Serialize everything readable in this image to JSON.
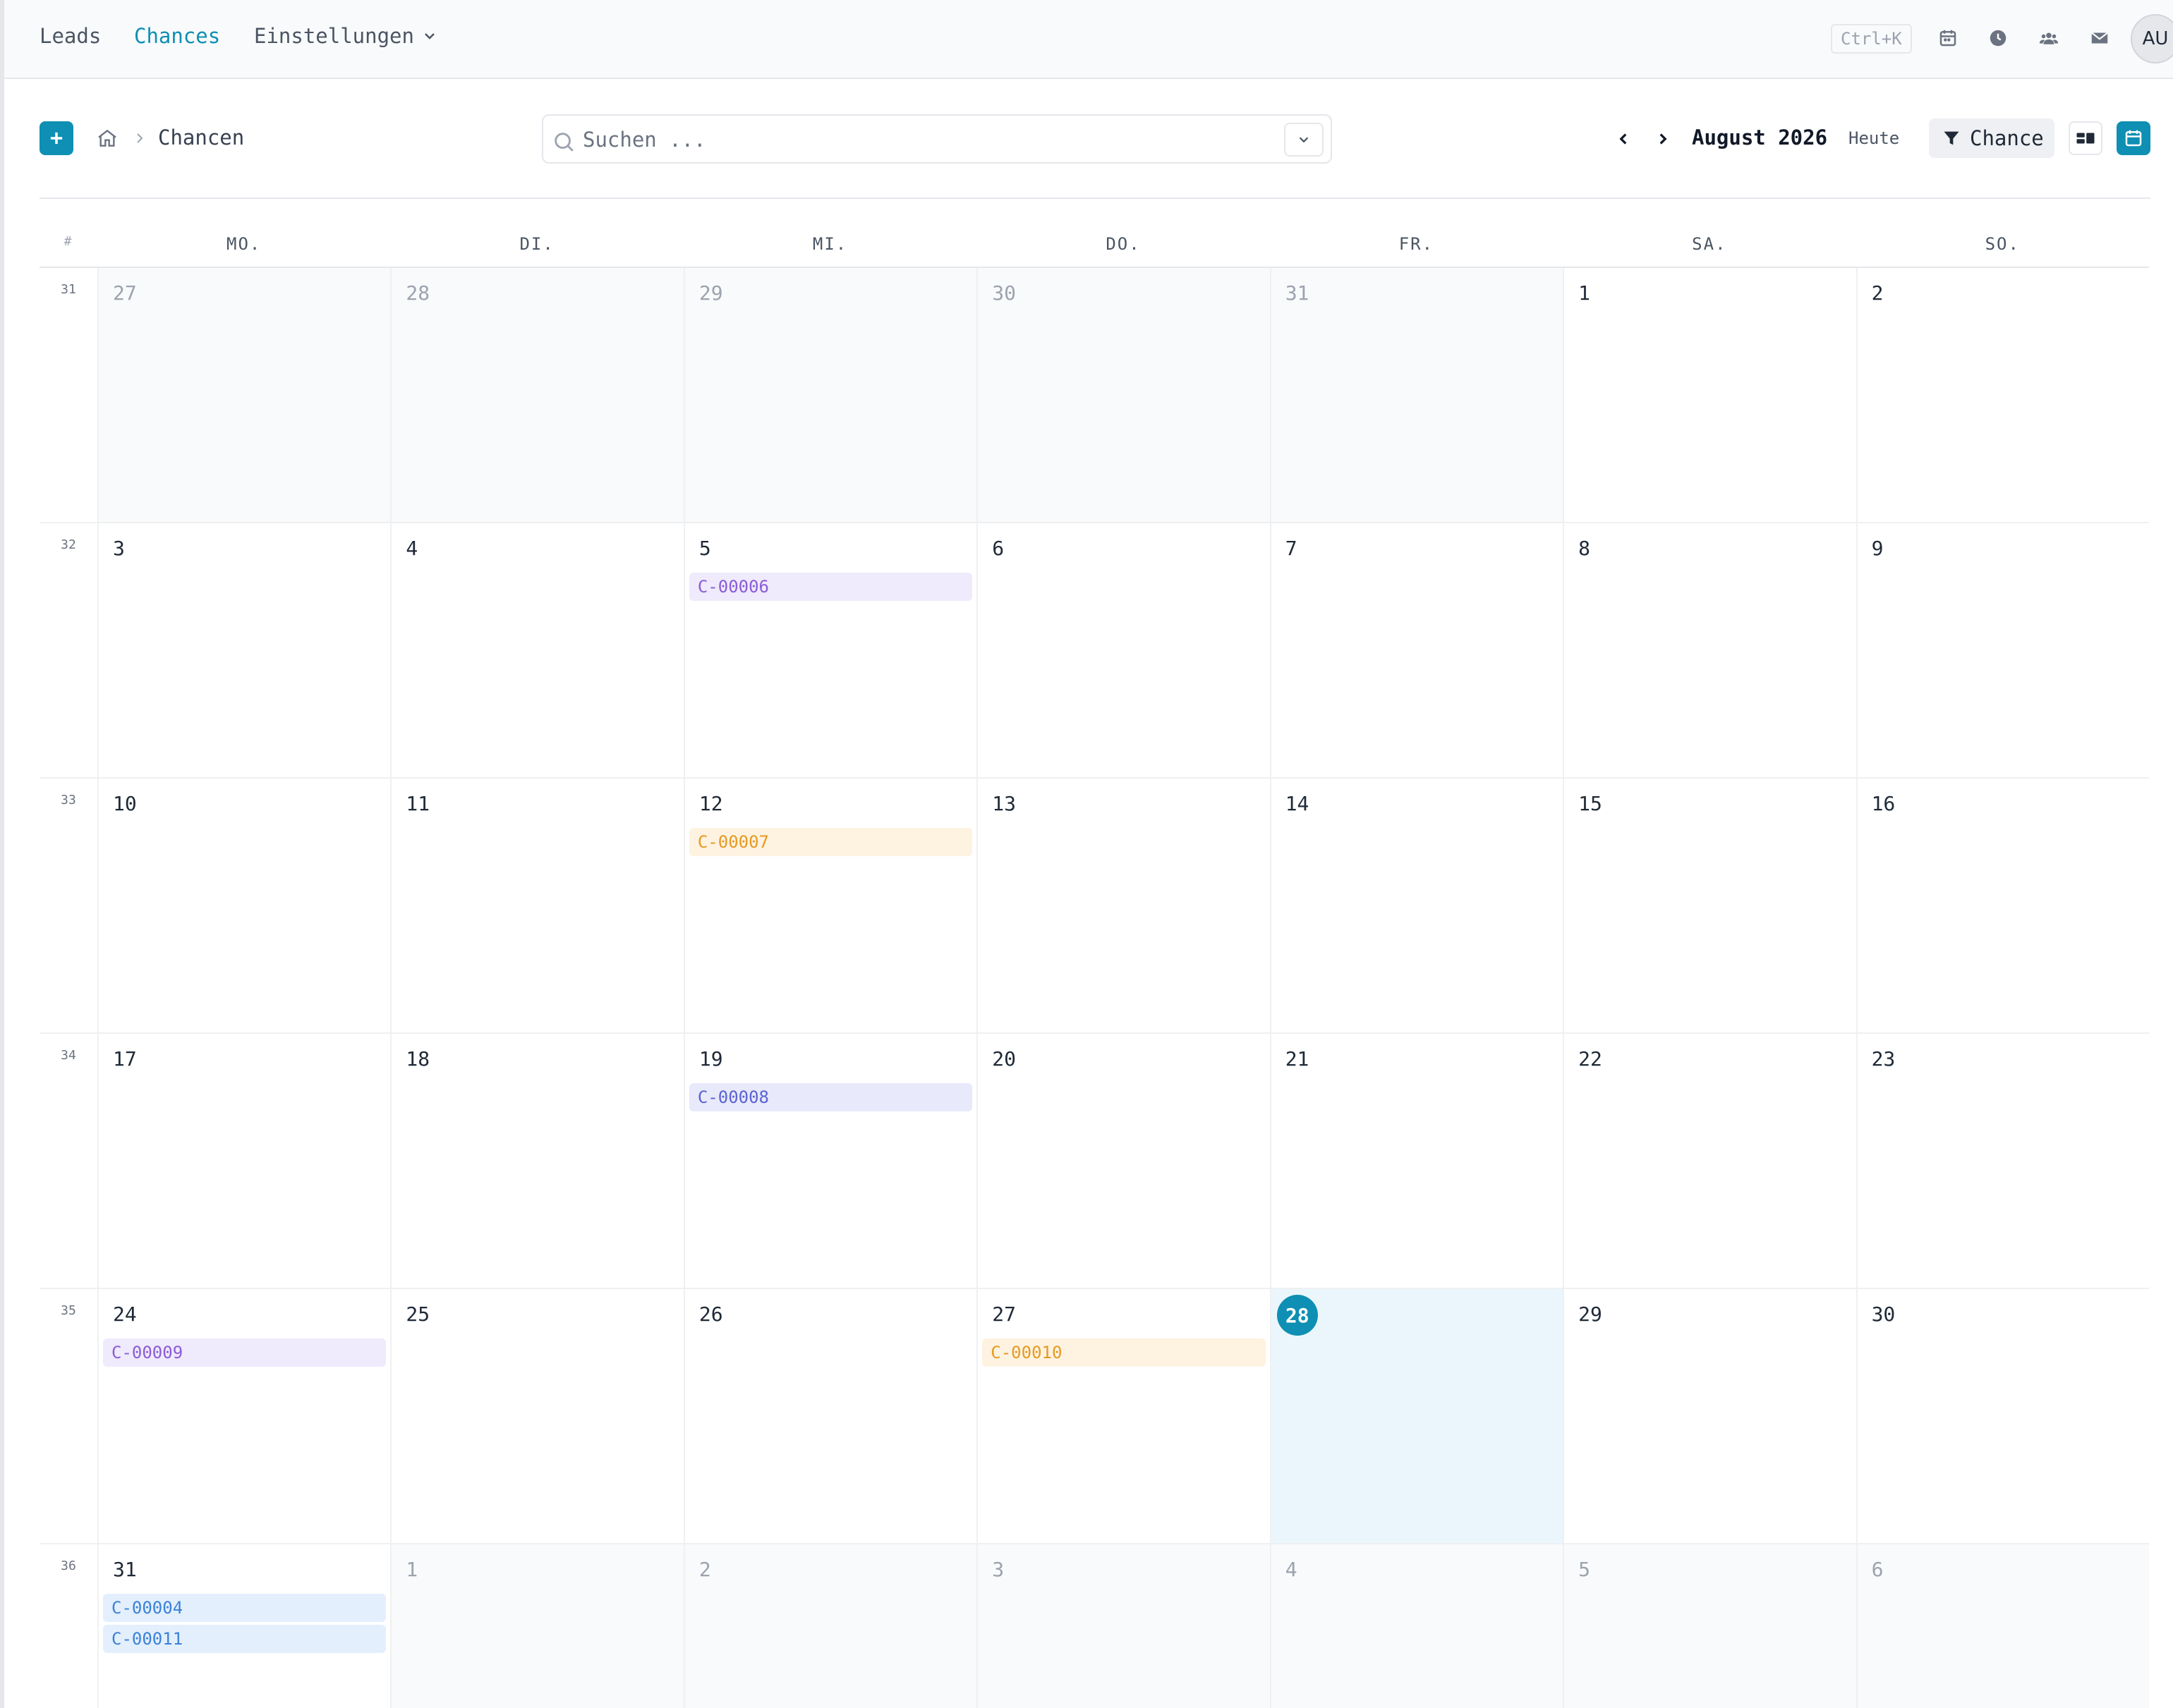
{
  "nav": {
    "leads": "Leads",
    "chances": "Chances",
    "settings": "Einstellungen",
    "shortcut": "Ctrl+K",
    "avatar": "AU",
    "icons": [
      "calendar-icon",
      "clock-icon",
      "users-icon",
      "mail-icon"
    ]
  },
  "breadcrumb": {
    "current": "Chancen"
  },
  "search": {
    "placeholder": "Suchen ..."
  },
  "calendar_nav": {
    "month": "August 2026",
    "today": "Heute",
    "filter": "Chance"
  },
  "colors": {
    "accent": "#0e8fb3",
    "event_purple": "#8b5cd6",
    "event_orange": "#e79a21",
    "event_indigo": "#5b63d3",
    "event_blue": "#3b82d6"
  },
  "calendar": {
    "week_header": "#",
    "weekdays": [
      "MO.",
      "DI.",
      "MI.",
      "DO.",
      "FR.",
      "SA.",
      "SO."
    ],
    "weeks": [
      {
        "number": "31",
        "days": [
          {
            "n": "27",
            "muted": true
          },
          {
            "n": "28",
            "muted": true
          },
          {
            "n": "29",
            "muted": true
          },
          {
            "n": "30",
            "muted": true
          },
          {
            "n": "31",
            "muted": true
          },
          {
            "n": "1"
          },
          {
            "n": "2"
          }
        ]
      },
      {
        "number": "32",
        "days": [
          {
            "n": "3"
          },
          {
            "n": "4"
          },
          {
            "n": "5",
            "events": [
              {
                "label": "C-00006",
                "color": "purple"
              }
            ]
          },
          {
            "n": "6"
          },
          {
            "n": "7"
          },
          {
            "n": "8"
          },
          {
            "n": "9"
          }
        ]
      },
      {
        "number": "33",
        "days": [
          {
            "n": "10"
          },
          {
            "n": "11"
          },
          {
            "n": "12",
            "events": [
              {
                "label": "C-00007",
                "color": "orange"
              }
            ]
          },
          {
            "n": "13"
          },
          {
            "n": "14"
          },
          {
            "n": "15"
          },
          {
            "n": "16"
          }
        ]
      },
      {
        "number": "34",
        "days": [
          {
            "n": "17"
          },
          {
            "n": "18"
          },
          {
            "n": "19",
            "events": [
              {
                "label": "C-00008",
                "color": "indigo"
              }
            ]
          },
          {
            "n": "20"
          },
          {
            "n": "21"
          },
          {
            "n": "22"
          },
          {
            "n": "23"
          }
        ]
      },
      {
        "number": "35",
        "days": [
          {
            "n": "24",
            "events": [
              {
                "label": "C-00009",
                "color": "purple"
              }
            ]
          },
          {
            "n": "25"
          },
          {
            "n": "26"
          },
          {
            "n": "27",
            "events": [
              {
                "label": "C-00010",
                "color": "orange"
              }
            ]
          },
          {
            "n": "28",
            "today": true
          },
          {
            "n": "29"
          },
          {
            "n": "30"
          }
        ]
      },
      {
        "number": "36",
        "days": [
          {
            "n": "31",
            "events": [
              {
                "label": "C-00004",
                "color": "blue"
              },
              {
                "label": "C-00011",
                "color": "blue"
              }
            ]
          },
          {
            "n": "1",
            "muted": true
          },
          {
            "n": "2",
            "muted": true
          },
          {
            "n": "3",
            "muted": true
          },
          {
            "n": "4",
            "muted": true
          },
          {
            "n": "5",
            "muted": true
          },
          {
            "n": "6",
            "muted": true
          }
        ]
      }
    ]
  }
}
